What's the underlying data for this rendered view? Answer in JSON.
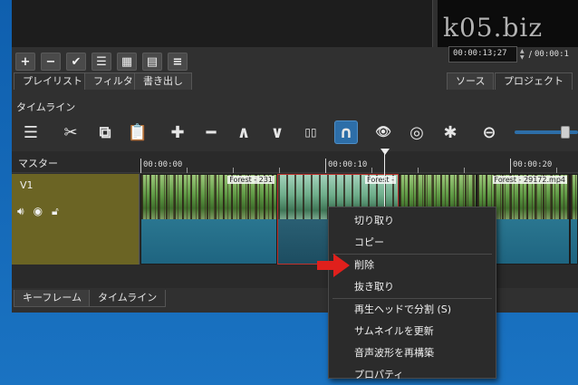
{
  "watermark": "k05.biz",
  "playlist_toolbar": {
    "buttons": [
      {
        "name": "add-icon",
        "glyph": "+"
      },
      {
        "name": "remove-icon",
        "glyph": "−"
      },
      {
        "name": "check-icon",
        "glyph": "✔"
      },
      {
        "name": "list-view-icon",
        "glyph": "☰"
      },
      {
        "name": "grid-view-icon",
        "glyph": "▦"
      },
      {
        "name": "details-view-icon",
        "glyph": "▤"
      },
      {
        "name": "menu-icon",
        "glyph": "≡"
      }
    ]
  },
  "timecode": {
    "position": "00:00:13;27",
    "separator": "/",
    "duration": "00:00:1"
  },
  "upper_tabs": {
    "playlist": "プレイリスト",
    "filter": "フィルタ",
    "export": "書き出し",
    "source": "ソース",
    "project": "プロジェクト"
  },
  "timeline_title": "タイムライン",
  "timeline_toolbar": {
    "menu": "☰",
    "cut": "✂",
    "copy": "⧉",
    "paste": "📋",
    "append": "✚",
    "remove": "━",
    "lift": "∧",
    "overwrite": "∨",
    "split": "▯▯",
    "snap": "∩",
    "scrub": "👁",
    "ripple": "◎",
    "ripple_all": "✱",
    "zoom_out": "⊖"
  },
  "ruler": {
    "master_label": "マスター",
    "ticks": [
      "00:00:00",
      "00:00:10",
      "00:00:20"
    ]
  },
  "track": {
    "name": "V1",
    "icons": [
      "speaker-icon",
      "eye-icon",
      "lock-icon"
    ]
  },
  "clips": [
    {
      "label": "Forest - 231",
      "selected": false
    },
    {
      "label": "Forest -",
      "selected": true
    },
    {
      "label": "",
      "selected": false
    },
    {
      "label": "Forest - 29172.mp4",
      "selected": false
    },
    {
      "label": "",
      "selected": false
    }
  ],
  "bottom_tabs": {
    "keyframes": "キーフレーム",
    "timeline": "タイムライン"
  },
  "context_menu": {
    "cut": "切り取り",
    "copy": "コピー",
    "delete": "削除",
    "lift": "抜き取り",
    "split_at_playhead": "再生ヘッドで分割 (S)",
    "update_thumbnails": "サムネイルを更新",
    "rebuild_waveform": "音声波形を再構築",
    "properties": "プロパティ"
  },
  "colors": {
    "accent": "#2d6ea8",
    "track_header": "#6b6424",
    "selected_clip_border": "#c0322d",
    "pointer_arrow": "#e0201c"
  }
}
